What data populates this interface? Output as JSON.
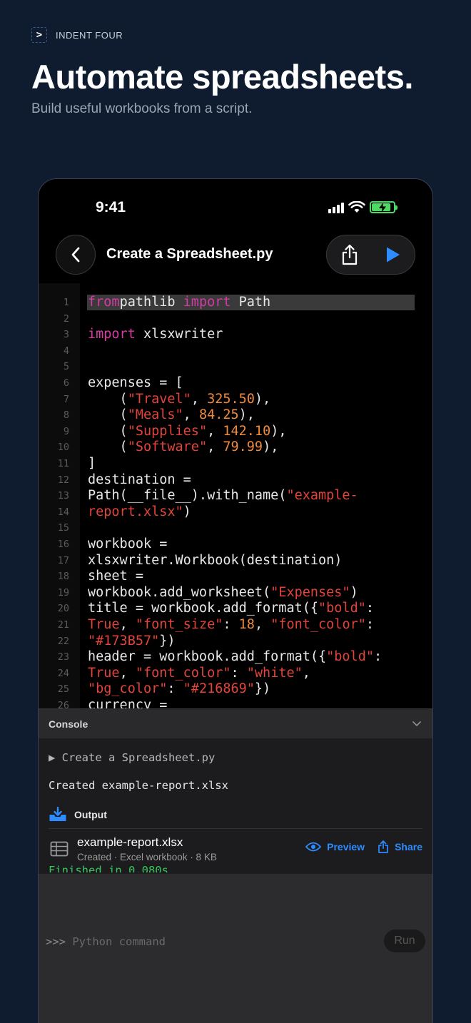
{
  "brand": {
    "logo_glyph": ">",
    "name": "INDENT FOUR"
  },
  "headline": "Automate spreadsheets.",
  "subheadline": "Build useful workbooks from a script.",
  "status_bar": {
    "time": "9:41",
    "icons": [
      "cellular-signal-icon",
      "wifi-icon",
      "battery-charging-icon"
    ]
  },
  "navbar": {
    "title": "Create a Spreadsheet.py",
    "back_icon": "chevron-left-icon",
    "share_icon": "share-icon",
    "run_icon": "play-icon"
  },
  "editor": {
    "highlighted_line": 1,
    "lines": [
      {
        "n": "1",
        "tokens": [
          [
            "kw",
            "from"
          ],
          [
            "",
            "pathlib "
          ],
          [
            "kw",
            "import"
          ],
          [
            "",
            " Path"
          ]
        ]
      },
      {
        "n": "2",
        "tokens": []
      },
      {
        "n": "3",
        "tokens": [
          [
            "kw",
            "import"
          ],
          [
            "",
            " xlsxwriter"
          ]
        ]
      },
      {
        "n": "4",
        "tokens": []
      },
      {
        "n": "5",
        "tokens": []
      },
      {
        "n": "6",
        "tokens": [
          [
            "",
            "expenses = ["
          ]
        ]
      },
      {
        "n": "7",
        "tokens": [
          [
            "",
            "    ("
          ],
          [
            "str",
            "\"Travel\""
          ],
          [
            "",
            ", "
          ],
          [
            "num",
            "325.50"
          ],
          [
            "",
            "),"
          ]
        ]
      },
      {
        "n": "8",
        "tokens": [
          [
            "",
            "    ("
          ],
          [
            "str",
            "\"Meals\""
          ],
          [
            "",
            ", "
          ],
          [
            "num",
            "84.25"
          ],
          [
            "",
            "),"
          ]
        ]
      },
      {
        "n": "9",
        "tokens": [
          [
            "",
            "    ("
          ],
          [
            "str",
            "\"Supplies\""
          ],
          [
            "",
            ", "
          ],
          [
            "num",
            "142.10"
          ],
          [
            "",
            "),"
          ]
        ]
      },
      {
        "n": "10",
        "tokens": [
          [
            "",
            "    ("
          ],
          [
            "str",
            "\"Software\""
          ],
          [
            "",
            ", "
          ],
          [
            "num",
            "79.99"
          ],
          [
            "",
            "),"
          ]
        ]
      },
      {
        "n": "11",
        "tokens": [
          [
            "",
            "]"
          ]
        ]
      },
      {
        "n": "12",
        "tokens": [
          [
            "",
            "destination ="
          ]
        ]
      },
      {
        "n": "13",
        "tokens": [
          [
            "",
            "Path(__file__).with_name("
          ],
          [
            "str",
            "\"example-"
          ]
        ]
      },
      {
        "n": "14",
        "tokens": [
          [
            "str",
            "report.xlsx\""
          ],
          [
            "",
            ")"
          ]
        ]
      },
      {
        "n": "15",
        "tokens": []
      },
      {
        "n": "16",
        "tokens": [
          [
            "",
            "workbook ="
          ]
        ]
      },
      {
        "n": "17",
        "tokens": [
          [
            "",
            "xlsxwriter.Workbook(destination)"
          ]
        ]
      },
      {
        "n": "18",
        "tokens": [
          [
            "",
            "sheet ="
          ]
        ]
      },
      {
        "n": "19",
        "tokens": [
          [
            "",
            "workbook.add_worksheet("
          ],
          [
            "str",
            "\"Expenses\""
          ],
          [
            "",
            ")"
          ]
        ]
      },
      {
        "n": "20",
        "tokens": [
          [
            "",
            "title = workbook.add_format({"
          ],
          [
            "str",
            "\"bold\""
          ],
          [
            "",
            ":"
          ]
        ]
      },
      {
        "n": "21",
        "tokens": [
          [
            "bool",
            "True"
          ],
          [
            "",
            ", "
          ],
          [
            "str",
            "\"font_size\""
          ],
          [
            "",
            ": "
          ],
          [
            "num",
            "18"
          ],
          [
            "",
            ", "
          ],
          [
            "str",
            "\"font_color\""
          ],
          [
            "",
            ":"
          ]
        ]
      },
      {
        "n": "22",
        "tokens": [
          [
            "str",
            "\"#173B57\""
          ],
          [
            "",
            "})"
          ]
        ]
      },
      {
        "n": "23",
        "tokens": [
          [
            "",
            "header = workbook.add_format({"
          ],
          [
            "str",
            "\"bold\""
          ],
          [
            "",
            ":"
          ]
        ]
      },
      {
        "n": "24",
        "tokens": [
          [
            "bool",
            "True"
          ],
          [
            "",
            ", "
          ],
          [
            "str",
            "\"font_color\""
          ],
          [
            "",
            ": "
          ],
          [
            "str",
            "\"white\""
          ],
          [
            "",
            ","
          ]
        ]
      },
      {
        "n": "25",
        "tokens": [
          [
            "str",
            "\"bg_color\""
          ],
          [
            "",
            ": "
          ],
          [
            "str",
            "\"#216869\""
          ],
          [
            "",
            "})"
          ]
        ]
      },
      {
        "n": "26",
        "tokens": [
          [
            "",
            "currency ="
          ]
        ]
      }
    ]
  },
  "console": {
    "title": "Console",
    "collapse_icon": "chevron-down-icon",
    "run_entry": "▶ Create a Spreadsheet.py",
    "created_message": "Created example-report.xlsx",
    "output_label": "Output",
    "output_icon": "tray-download-icon",
    "file": {
      "name": "example-report.xlsx",
      "meta": "Created · Excel workbook · 8 KB",
      "icon": "table-icon",
      "preview_label": "Preview",
      "share_label": "Share"
    },
    "finished_message": "Finished in 0.080s",
    "prompt": ">>>",
    "input_placeholder": "Python command",
    "run_button": "Run"
  },
  "colors": {
    "background": "#0f1b2e",
    "keyword": "#d63aa5",
    "string": "#e2443a",
    "number": "#f08a3c",
    "accent": "#2d8cff",
    "battery": "#4cd964",
    "success": "#34c759"
  }
}
